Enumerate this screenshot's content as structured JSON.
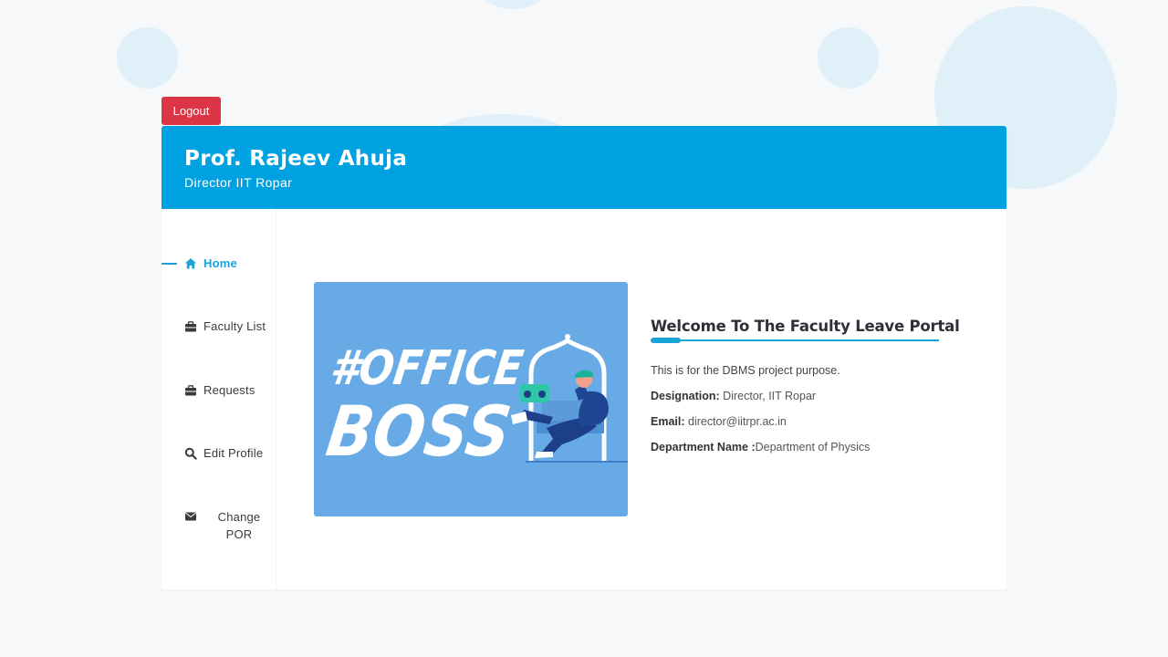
{
  "logout_label": "Logout",
  "header": {
    "name": "Prof. Rajeev Ahuja",
    "subtitle": "Director IIT Ropar"
  },
  "sidebar": {
    "items": [
      {
        "label": "Home",
        "icon": "home-icon",
        "active": true
      },
      {
        "label": "Faculty List",
        "icon": "briefcase-icon"
      },
      {
        "label": "Requests",
        "icon": "briefcase-icon"
      },
      {
        "label": "Edit Profile",
        "icon": "search-icon"
      },
      {
        "label": "Change",
        "label2": "POR",
        "icon": "envelope-icon"
      }
    ]
  },
  "illustration": {
    "line1": "#OFFICE",
    "line2": "BOSS"
  },
  "welcome": {
    "title": "Welcome To The Faculty Leave Portal",
    "description": "This is for the DBMS project purpose.",
    "designation_label": "Designation:",
    "designation_value": " Director, IIT Ropar",
    "email_label": "Email:",
    "email_value": " director@iitrpr.ac.in",
    "department_label": "Department Name :",
    "department_value": "Department of Physics"
  },
  "colors": {
    "accent": "#00a1e0",
    "logout": "#dc3545",
    "illustration_bg": "#67aae5"
  }
}
